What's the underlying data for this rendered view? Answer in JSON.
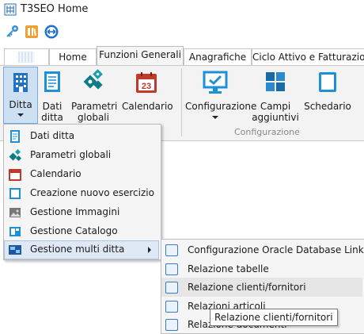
{
  "window": {
    "title": "T3SEO Home"
  },
  "tabs": [
    {
      "label": ""
    },
    {
      "label": "Home"
    },
    {
      "label": "Funzioni Generali"
    },
    {
      "label": "Anagrafiche"
    },
    {
      "label": "Ciclo Attivo e Fatturazione"
    }
  ],
  "ribbon": {
    "buttons": [
      {
        "label_line1": "Ditta",
        "label_line2": "",
        "icon": "building-icon"
      },
      {
        "label_line1": "Dati",
        "label_line2": "ditta",
        "icon": "document-icon"
      },
      {
        "label_line1": "Parametri",
        "label_line2": "globali",
        "icon": "gears-icon"
      },
      {
        "label_line1": "Calendario",
        "label_line2": "",
        "icon": "calendar-icon",
        "calendar_day": "23"
      },
      {
        "label_line1": "Configurazione",
        "label_line2": "",
        "icon": "monitor-check-icon"
      },
      {
        "label_line1": "Campi",
        "label_line2": "aggiuntivi",
        "icon": "grid-plus-icon"
      },
      {
        "label_line1": "Schedario",
        "label_line2": "",
        "icon": "card-file-icon"
      }
    ],
    "group_label": "Configurazione"
  },
  "ditta_menu": [
    {
      "label": "Dati ditta",
      "icon": "document-icon"
    },
    {
      "label": "Parametri globali",
      "icon": "gears-icon"
    },
    {
      "label": "Calendario",
      "icon": "calendar-icon"
    },
    {
      "label": "Creazione nuovo esercizio",
      "icon": "new-year-icon"
    },
    {
      "label": "Gestione Immagini",
      "icon": "image-icon"
    },
    {
      "label": "Gestione Catalogo",
      "icon": "catalog-icon"
    },
    {
      "label": "Gestione multi ditta",
      "icon": "multi-company-icon"
    }
  ],
  "submenu": [
    {
      "label": "Configurazione Oracle Database Link"
    },
    {
      "label": "Relazione tabelle"
    },
    {
      "label": "Relazione clienti/fornitori"
    },
    {
      "label": "Relazioni articoli"
    },
    {
      "label": "Relazione documenti"
    }
  ],
  "tooltip": "Relazione clienti/fornitori",
  "colors": {
    "accent": "#1e72c8",
    "ribbon_bg": "#f3f3f3",
    "menu_bg": "#f5f5f5",
    "calendar": "#c0392b"
  }
}
